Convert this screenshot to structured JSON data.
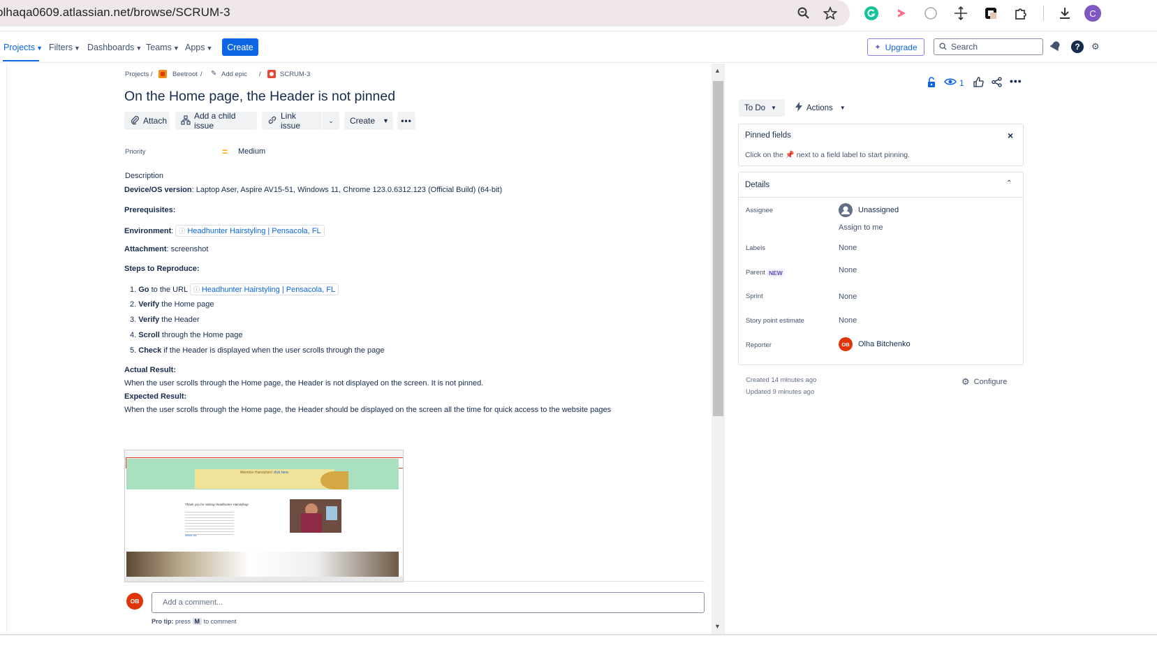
{
  "browser": {
    "url": "olhaqa0609.atlassian.net/browse/SCRUM-3",
    "profile_initial": "C"
  },
  "nav": {
    "projects": "Projects",
    "filters": "Filters",
    "dashboards": "Dashboards",
    "teams": "Teams",
    "apps": "Apps",
    "create": "Create",
    "upgrade": "Upgrade",
    "search_placeholder": "Search"
  },
  "breadcrumb": {
    "projects": "Projects",
    "project": "Beetroot",
    "add_epic": "Add epic",
    "issue_key": "SCRUM-3"
  },
  "issue": {
    "title": "On the Home page, the Header is not pinned",
    "toolbar": {
      "attach": "Attach",
      "add_child": "Add a child issue",
      "link_issue": "Link issue",
      "create": "Create"
    },
    "priority_label": "Priority",
    "priority_value": "Medium",
    "description_label": "Description",
    "device_label": "Device/OS version",
    "device_value": ": Laptop Aser, Aspire AV15-51, Windows 11, Chrome 123.0.6312.123 (Official Build) (64-bit)",
    "prereq_label": "Prerequisites",
    "environment_label": "Environment",
    "environment_link": "Headhunter Hairstyling | Pensacola, FL",
    "attachment_label": "Attachment",
    "attachment_value": ": screenshot",
    "steps_label": "Steps to Reproduce",
    "steps": [
      {
        "num": "1.",
        "verb": "Go",
        "rest": " to the URL",
        "link": "Headhunter Hairstyling | Pensacola, FL"
      },
      {
        "num": "2.",
        "verb": "Verify",
        "rest": " the Home page"
      },
      {
        "num": "3.",
        "verb": "Verify",
        "rest": " the Header"
      },
      {
        "num": "4.",
        "verb": "Scroll",
        "rest": " through the Home page"
      },
      {
        "num": "5.",
        "verb": "Check",
        "rest": " if the Header is displayed when the user scrolls through the page"
      }
    ],
    "actual_label": "Actual Result",
    "actual_text": "When the user scrolls through the Home page, the Header is not displayed on the screen. It is not pinned.",
    "expected_label": "Expected Result",
    "expected_text": "When the user scrolls through the Home page, the Header should be displayed on the screen all the time for quick access to the website pages",
    "comment_placeholder": "Add a comment...",
    "pro_tip_label": "Pro tip:",
    "pro_tip_press": "press",
    "pro_tip_key": "M",
    "pro_tip_rest": "to comment",
    "user_initials": "OB"
  },
  "side": {
    "watch_count": "1",
    "status": "To Do",
    "actions": "Actions",
    "pinned_title": "Pinned fields",
    "pinned_hint_a": "Click on the",
    "pinned_hint_b": "next to a field label to start pinning.",
    "details_title": "Details",
    "assignee_label": "Assignee",
    "assignee_value": "Unassigned",
    "assign_to_me": "Assign to me",
    "labels_label": "Labels",
    "labels_value": "None",
    "parent_label": "Parent",
    "parent_badge": "NEW",
    "parent_value": "None",
    "sprint_label": "Sprint",
    "sprint_value": "None",
    "story_label": "Story point estimate",
    "story_value": "None",
    "reporter_label": "Reporter",
    "reporter_value": "Olha Bitchenko",
    "reporter_initials": "OB",
    "created": "Created 14 minutes ago",
    "updated": "Updated 9 minutes ago",
    "configure": "Configure"
  },
  "thumbnail": {
    "banner_title": "Attention Hairstylists!",
    "banner_link": "click here.",
    "welcome": "Thank you for visiting Headhunter Hairstyling!",
    "about_link": "About Us"
  },
  "colors": {
    "accent": "#0c66e4",
    "avatar": "#de350b",
    "priority": "#ffab00"
  }
}
